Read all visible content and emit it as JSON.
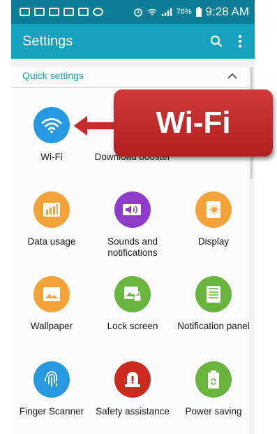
{
  "status_bar": {
    "battery": "76%",
    "time": "9:28 AM"
  },
  "app_bar": {
    "title": "Settings"
  },
  "section": {
    "title": "Quick settings"
  },
  "tiles": [
    {
      "label": "Wi-Fi",
      "color": "#2799e0",
      "icon": "wifi-icon"
    },
    {
      "label": "Download booster",
      "color": "#2799e0",
      "icon": "booster-icon"
    },
    {
      "label": "Data usage",
      "color": "#f2a43a",
      "icon": "data-usage-icon"
    },
    {
      "label": "Sounds and notifications",
      "color": "#8c3cc9",
      "icon": "volume-icon"
    },
    {
      "label": "Display",
      "color": "#f2a43a",
      "icon": "display-icon"
    },
    {
      "label": "Wallpaper",
      "color": "#f2a43a",
      "icon": "wallpaper-icon"
    },
    {
      "label": "Lock screen",
      "color": "#68b43c",
      "icon": "lock-screen-icon"
    },
    {
      "label": "Notification panel",
      "color": "#68b43c",
      "icon": "notification-panel-icon"
    },
    {
      "label": "Finger Scanner",
      "color": "#2799e0",
      "icon": "fingerprint-icon"
    },
    {
      "label": "Safety assistance",
      "color": "#cc2a1e",
      "icon": "safety-icon"
    },
    {
      "label": "Power saving",
      "color": "#68b43c",
      "icon": "battery-icon"
    }
  ],
  "callout": {
    "text": "Wi-Fi",
    "color": "#c42b2b"
  }
}
